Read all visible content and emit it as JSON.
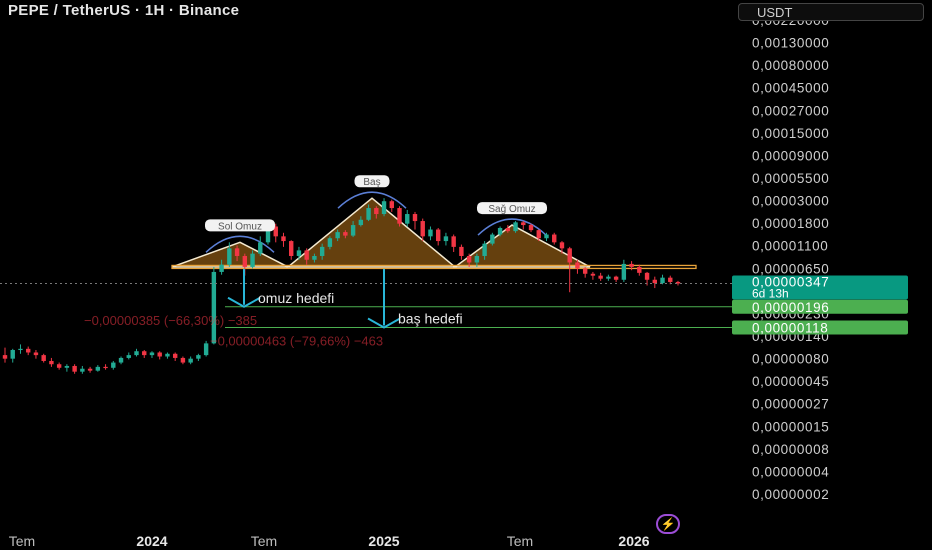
{
  "header": {
    "title": "PEPE / TetherUS · 1H · Binance",
    "unit_label": "USDT"
  },
  "colors": {
    "up": "#22ab94",
    "down": "#f23645",
    "pattern_fill": "#b8741a",
    "neckline": "#e8a33a",
    "target_arrow": "#29b6d8",
    "target_line": "#4caf50",
    "price_label_bg": "#089981",
    "target_label_bg": "#4caf50"
  },
  "icons": {
    "bottom_badge": "lightning-icon"
  },
  "chart_data": {
    "type": "candlestick",
    "y_scale": "log",
    "y_ticks": [
      "0,00220000",
      "0,00130000",
      "0,00080000",
      "0,00045000",
      "0,00027000",
      "0,00015000",
      "0,00009000",
      "0,00005500",
      "0,00003000",
      "0,00001800",
      "0,00001100",
      "0,00000650",
      "0,00000400",
      "0,00000230",
      "0,00000140",
      "0,00000080",
      "0,00000045",
      "0,00000027",
      "0,00000015",
      "0,00000008",
      "0,00000004",
      "0,00000002"
    ],
    "x_ticks": [
      "Tem",
      "2024",
      "Tem",
      "2025",
      "Tem",
      "2026"
    ],
    "current_price": {
      "value": "0,00000347",
      "countdown": "6d 13h"
    },
    "targets": [
      {
        "value": "0,00000196",
        "label": "omuz hedefi",
        "measure": "−0,00000385 (−66,30%) −385"
      },
      {
        "value": "0,00000118",
        "label": "baş hedefi",
        "measure": "−0,00000463 (−79,66%) −463"
      }
    ],
    "pattern_labels": {
      "left_shoulder": "Sol Omuz",
      "head": "Baş",
      "right_shoulder": "Sağ Omuz"
    },
    "neckline_value": 5.2e-06,
    "candles": [
      [
        6e-07,
        5.5e-07,
        7.2e-07,
        5e-07
      ],
      [
        5.5e-07,
        6.8e-07,
        7e-07,
        5e-07
      ],
      [
        6.8e-07,
        7e-07,
        7.8e-07,
        6.2e-07
      ],
      [
        7e-07,
        6.4e-07,
        7.4e-07,
        6e-07
      ],
      [
        6.4e-07,
        6e-07,
        6.8e-07,
        5.5e-07
      ],
      [
        6e-07,
        5.2e-07,
        6.2e-07,
        5e-07
      ],
      [
        5.2e-07,
        4.8e-07,
        5.6e-07,
        4.5e-07
      ],
      [
        4.8e-07,
        4.4e-07,
        5e-07,
        4.2e-07
      ],
      [
        4.4e-07,
        4.6e-07,
        4.8e-07,
        4e-07
      ],
      [
        4.6e-07,
        4e-07,
        4.8e-07,
        3.8e-07
      ],
      [
        4e-07,
        4.3e-07,
        4.6e-07,
        3.8e-07
      ],
      [
        4.3e-07,
        4.1e-07,
        4.5e-07,
        3.9e-07
      ],
      [
        4.1e-07,
        4.5e-07,
        4.7e-07,
        4e-07
      ],
      [
        4.5e-07,
        4.4e-07,
        4.8e-07,
        4.2e-07
      ],
      [
        4.4e-07,
        5e-07,
        5.2e-07,
        4.2e-07
      ],
      [
        5e-07,
        5.6e-07,
        5.8e-07,
        4.8e-07
      ],
      [
        5.6e-07,
        6e-07,
        6.4e-07,
        5.4e-07
      ],
      [
        6e-07,
        6.6e-07,
        7e-07,
        5.8e-07
      ],
      [
        6.6e-07,
        6e-07,
        6.8e-07,
        5.6e-07
      ],
      [
        6e-07,
        6.4e-07,
        6.6e-07,
        5.6e-07
      ],
      [
        6.4e-07,
        5.8e-07,
        6.6e-07,
        5.4e-07
      ],
      [
        5.8e-07,
        6.2e-07,
        6.4e-07,
        5.5e-07
      ],
      [
        6.2e-07,
        5.6e-07,
        6.4e-07,
        5.2e-07
      ],
      [
        5.6e-07,
        5e-07,
        5.8e-07,
        4.8e-07
      ],
      [
        5e-07,
        5.5e-07,
        5.8e-07,
        4.8e-07
      ],
      [
        5.5e-07,
        6e-07,
        6.2e-07,
        5.2e-07
      ],
      [
        6e-07,
        8e-07,
        8.5e-07,
        5.8e-07
      ],
      [
        8e-07,
        4.6e-06,
        5.2e-06,
        7.8e-07
      ],
      [
        4.6e-06,
        5.5e-06,
        6.2e-06,
        4.3e-06
      ],
      [
        5.5e-06,
        8.2e-06,
        9.5e-06,
        5.2e-06
      ],
      [
        8.2e-06,
        6.8e-06,
        8.8e-06,
        6e-06
      ],
      [
        6.8e-06,
        5.2e-06,
        7.2e-06,
        4.2e-06
      ],
      [
        5.2e-06,
        7.2e-06,
        7.8e-06,
        5e-06
      ],
      [
        7.2e-06,
        9.5e-06,
        1.1e-05,
        6.8e-06
      ],
      [
        9.5e-06,
        1.4e-05,
        1.6e-05,
        9e-06
      ],
      [
        1.4e-05,
        1.1e-05,
        1.5e-05,
        9.5e-06
      ],
      [
        1.1e-05,
        9.8e-06,
        1.2e-05,
        8.5e-06
      ],
      [
        9.8e-06,
        6.8e-06,
        1e-05,
        6.2e-06
      ],
      [
        6.8e-06,
        7.8e-06,
        8.5e-06,
        6.2e-06
      ],
      [
        7.8e-06,
        6.2e-06,
        8.2e-06,
        5.5e-06
      ],
      [
        6.2e-06,
        6.8e-06,
        7.2e-06,
        5.8e-06
      ],
      [
        6.8e-06,
        8.5e-06,
        9.2e-06,
        6.2e-06
      ],
      [
        8.5e-06,
        1.05e-05,
        1.1e-05,
        8e-06
      ],
      [
        1.05e-05,
        1.22e-05,
        1.3e-05,
        9.8e-06
      ],
      [
        1.22e-05,
        1.12e-05,
        1.28e-05,
        1.05e-05
      ],
      [
        1.12e-05,
        1.45e-05,
        1.6e-05,
        1.08e-05
      ],
      [
        1.45e-05,
        1.65e-05,
        1.8e-05,
        1.4e-05
      ],
      [
        1.65e-05,
        2.2e-05,
        2.4e-05,
        1.6e-05
      ],
      [
        2.2e-05,
        1.9e-05,
        2.3e-05,
        1.7e-05
      ],
      [
        1.9e-05,
        2.6e-05,
        2.8e-05,
        1.8e-05
      ],
      [
        2.6e-05,
        2.2e-05,
        2.7e-05,
        2e-05
      ],
      [
        2.2e-05,
        1.5e-05,
        2.3e-05,
        1.4e-05
      ],
      [
        1.5e-05,
        1.9e-05,
        2.1e-05,
        1.4e-05
      ],
      [
        1.9e-05,
        1.6e-05,
        2e-05,
        1.3e-05
      ],
      [
        1.6e-05,
        1.1e-05,
        1.7e-05,
        9.8e-06
      ],
      [
        1.1e-05,
        1.3e-05,
        1.4e-05,
        1e-05
      ],
      [
        1.3e-05,
        9.8e-06,
        1.35e-05,
        8.8e-06
      ],
      [
        9.8e-06,
        1.1e-05,
        1.2e-05,
        8.8e-06
      ],
      [
        1.1e-05,
        8.5e-06,
        1.15e-05,
        7.5e-06
      ],
      [
        8.5e-06,
        6.8e-06,
        9e-06,
        6.2e-06
      ],
      [
        6.8e-06,
        5.8e-06,
        7.2e-06,
        5.2e-06
      ],
      [
        5.8e-06,
        6.8e-06,
        7.2e-06,
        5.2e-06
      ],
      [
        6.8e-06,
        9.2e-06,
        9.8e-06,
        6.2e-06
      ],
      [
        9.2e-06,
        1.15e-05,
        1.2e-05,
        8.8e-06
      ],
      [
        1.15e-05,
        1.35e-05,
        1.4e-05,
        1.1e-05
      ],
      [
        1.35e-05,
        1.25e-05,
        1.45e-05,
        1.2e-05
      ],
      [
        1.25e-05,
        1.55e-05,
        1.6e-05,
        1.2e-05
      ],
      [
        1.55e-05,
        1.45e-05,
        1.6e-05,
        1.3e-05
      ],
      [
        1.45e-05,
        1.28e-05,
        1.5e-05,
        1.22e-05
      ],
      [
        1.28e-05,
        1.05e-05,
        1.3e-05,
        9.8e-06
      ],
      [
        1.05e-05,
        1.15e-05,
        1.2e-05,
        9.8e-06
      ],
      [
        1.15e-05,
        9.5e-06,
        1.2e-05,
        9e-06
      ],
      [
        9.5e-06,
        8.2e-06,
        9.8e-06,
        7.2e-06
      ],
      [
        8.2e-06,
        5.8e-06,
        8.5e-06,
        2.8e-06
      ],
      [
        5.8e-06,
        5e-06,
        6.2e-06,
        4.4e-06
      ],
      [
        5e-06,
        4.4e-06,
        5.2e-06,
        4e-06
      ],
      [
        4.4e-06,
        4.2e-06,
        4.6e-06,
        3.8e-06
      ],
      [
        4.2e-06,
        3.9e-06,
        4.5e-06,
        3.7e-06
      ],
      [
        3.9e-06,
        4.1e-06,
        4.3e-06,
        3.7e-06
      ],
      [
        4.1e-06,
        3.8e-06,
        4.2e-06,
        3.6e-06
      ],
      [
        3.8e-06,
        5.6e-06,
        6.2e-06,
        3.6e-06
      ],
      [
        5.6e-06,
        5.2e-06,
        6e-06,
        4.8e-06
      ],
      [
        5.2e-06,
        4.5e-06,
        5.5e-06,
        4.2e-06
      ],
      [
        4.5e-06,
        3.8e-06,
        4.6e-06,
        3.3e-06
      ],
      [
        3.8e-06,
        3.5e-06,
        4.1e-06,
        3.1e-06
      ],
      [
        3.5e-06,
        4e-06,
        4.3e-06,
        3.4e-06
      ],
      [
        4e-06,
        3.6e-06,
        4.2e-06,
        3.4e-06
      ],
      [
        3.6e-06,
        3.47e-06,
        3.7e-06,
        3.3e-06
      ]
    ]
  }
}
